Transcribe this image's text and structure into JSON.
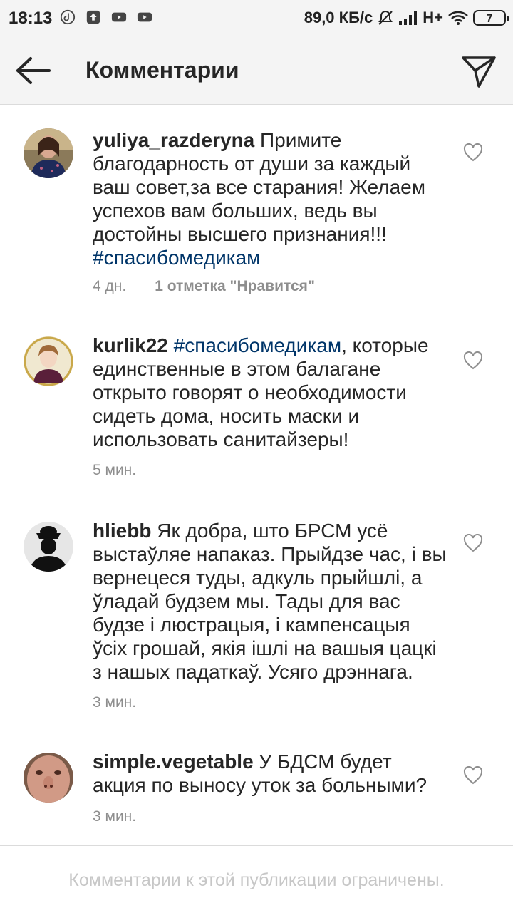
{
  "status_bar": {
    "time": "18:13",
    "speed": "89,0 КБ/с",
    "network": "H+",
    "battery": "7",
    "icons": [
      "tiktok-icon",
      "upload-icon",
      "youtube-icon",
      "youtube-icon",
      "mute-icon",
      "signal-icon",
      "wifi-icon",
      "battery-icon"
    ]
  },
  "header": {
    "title": "Комментарии",
    "back_icon": "arrow-left-icon",
    "send_icon": "send-icon"
  },
  "comments": [
    {
      "username": "yuliya_razderyna",
      "text": " Примите благодарность от души за каждый ваш совет,за все старания! Желаем успехов вам больших, ведь вы достойны высшего признания!!!",
      "hashtag": "#спасибомедикам",
      "time": "4 дн.",
      "likes": "1 отметка \"Нравится\""
    },
    {
      "username": "kurlik22",
      "hashtag": "#спасибомедикам",
      "text": ", которые единственные в этом балагане открыто говорят о необходимости сидеть дома, носить маски и использовать санитайзеры!",
      "time": "5 мин."
    },
    {
      "username": "hliebb",
      "text": " Як добра, што БРСМ усё выстаўляе напаказ. Прыйдзе час, і вы вернецеся туды, адкуль прыйшлі, а ўладай будзем мы. Тады для вас будзе і люстрацыя, і кампенсацыя ўсіх грошай, якія ішлі на вашыя цацкі з нашых падаткаў. Усяго дрэннага.",
      "time": "3 мин."
    },
    {
      "username": "simple.vegetable",
      "text": " У БДСМ будет акция по выносу уток за больными?",
      "time": "3 мин."
    }
  ],
  "footer": {
    "text": "Комментарии к этой публикации ограничены."
  },
  "colors": {
    "hashtag": "#003569",
    "meta": "#8e8e8e",
    "footer_text": "#c7c7c7",
    "bar_bg": "#f4f4f4"
  }
}
